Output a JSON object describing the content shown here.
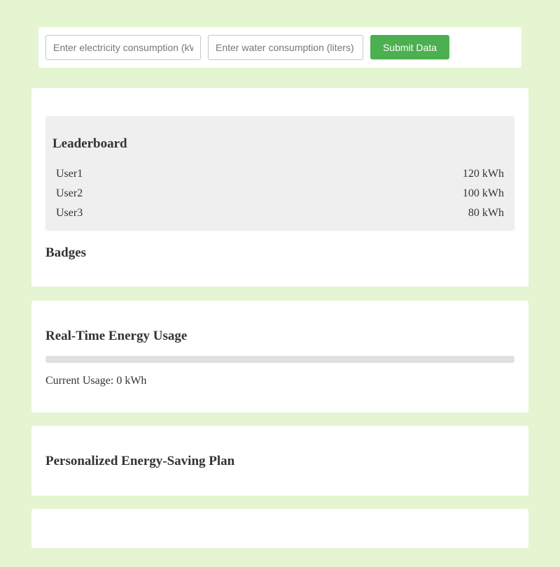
{
  "form": {
    "electricity_placeholder": "Enter electricity consumption (kWh)",
    "water_placeholder": "Enter water consumption (liters)",
    "submit_label": "Submit Data",
    "accent_color": "#4caf50"
  },
  "leaderboard": {
    "title": "Leaderboard",
    "entries": [
      {
        "user": "User1",
        "usage": "120 kWh"
      },
      {
        "user": "User2",
        "usage": "100 kWh"
      },
      {
        "user": "User3",
        "usage": "80 kWh"
      }
    ]
  },
  "badges": {
    "title": "Badges"
  },
  "realtime": {
    "title": "Real-Time Energy Usage",
    "progress_fraction": 0,
    "usage_prefix": "Current Usage: ",
    "usage_value": "0",
    "usage_unit": " kWh"
  },
  "plan": {
    "title": "Personalized Energy-Saving Plan"
  },
  "colors": {
    "page_background": "#e5f4d1",
    "card_background": "#ffffff",
    "leaderboard_background": "#efefef",
    "progress_track": "#e0e0e0",
    "text": "#333333"
  }
}
